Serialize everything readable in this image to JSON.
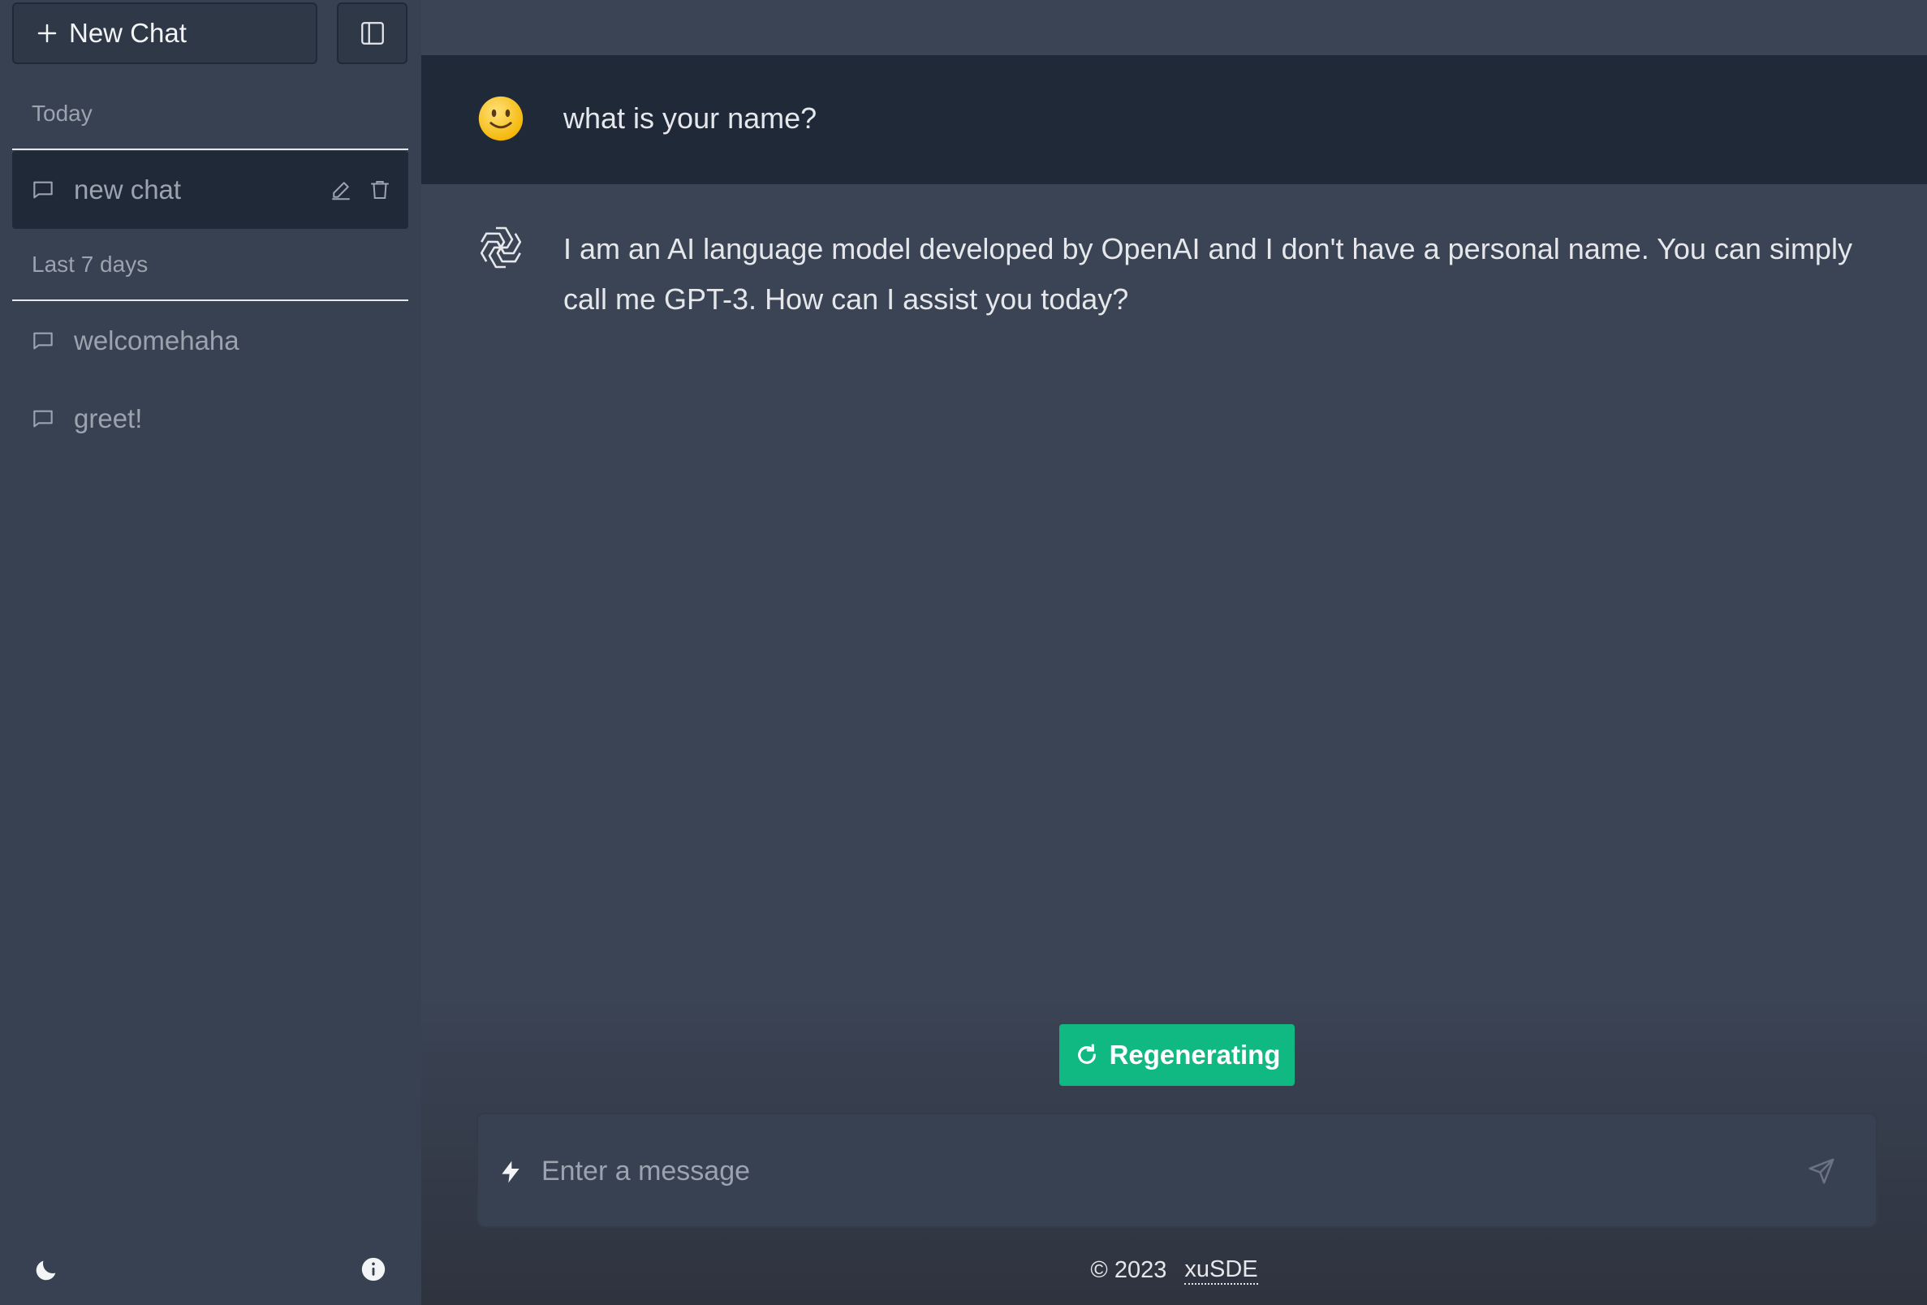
{
  "sidebar": {
    "new_chat_label": "New Chat",
    "sections": [
      {
        "label": "Today",
        "items": [
          {
            "label": "new chat",
            "active": true
          }
        ]
      },
      {
        "label": "Last 7 days",
        "items": [
          {
            "label": "welcomehaha"
          },
          {
            "label": "greet!"
          }
        ]
      }
    ]
  },
  "messages": [
    {
      "role": "user",
      "avatar": "smiley-face-emoji",
      "text": "what is your name?"
    },
    {
      "role": "assistant",
      "avatar": "openai-logo-icon",
      "text": "I am an AI language model developed by OpenAI and I don't have a personal name. You can simply call me GPT-3. How can I assist you today?"
    }
  ],
  "composer": {
    "regenerate_label": "Regenerating",
    "placeholder": "Enter a message"
  },
  "footer": {
    "copyright": "© 2023",
    "link": "xuSDE"
  },
  "colors": {
    "accent": "#10b981",
    "sidebar_bg": "#374151",
    "user_row_bg": "#1f2937",
    "main_bg": "#3b4455"
  }
}
